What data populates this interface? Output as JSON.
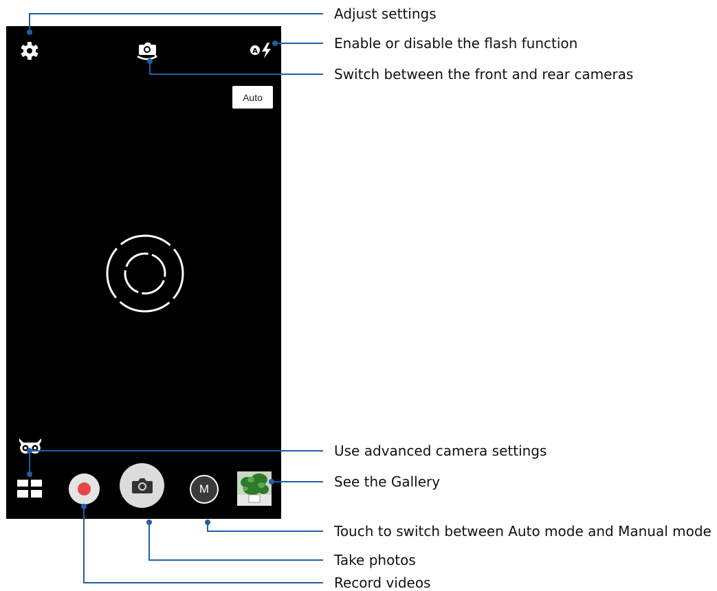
{
  "camera": {
    "scene_mode_label": "Auto",
    "mode_button_label": "M",
    "record_color": "#e8474a"
  },
  "icons": {
    "settings": "gear-icon",
    "switch_camera": "camera-switch-icon",
    "flash": "flash-auto-icon",
    "advanced": "owl-icon",
    "menu": "grid-icon",
    "shutter": "camera-icon",
    "gallery": "gallery-thumbnail"
  },
  "callouts": [
    "Adjust settings",
    "Enable or disable the flash function",
    "Switch between the front and rear cameras",
    "Use advanced camera settings",
    "See the Gallery",
    "Touch to switch between Auto mode and Manual mode",
    "Take photos",
    "Record videos"
  ],
  "accent_color": "#1f5fa6"
}
